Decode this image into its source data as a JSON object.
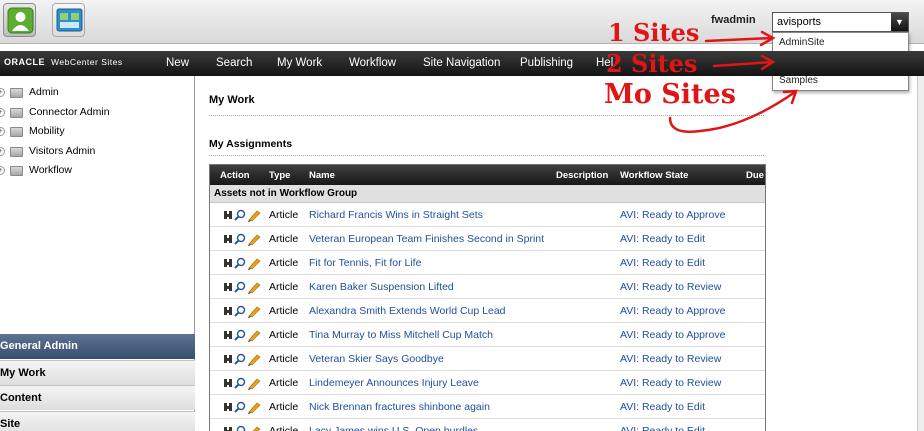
{
  "topbar": {
    "user": "fwadmin",
    "site_selected": "avisports",
    "site_options": [
      "AdminSite",
      "avisports",
      "Samples"
    ]
  },
  "navbar": {
    "logo": "ORACLE",
    "logo_sub": "WebCenter Sites",
    "items": [
      "New",
      "Search",
      "My Work",
      "Workflow",
      "Site Navigation",
      "Publishing",
      "Hel"
    ]
  },
  "sidebar": {
    "tree": [
      "Admin",
      "Connector Admin",
      "Mobility",
      "Visitors Admin",
      "Workflow"
    ],
    "accordion": [
      "General Admin",
      "My Work",
      "Content",
      "Site"
    ]
  },
  "main": {
    "title": "My Work",
    "section": "My Assignments",
    "columns": {
      "action": "Action",
      "type": "Type",
      "name": "Name",
      "description": "Description",
      "workflow_state": "Workflow State",
      "due": "Due"
    },
    "group": "Assets not in Workflow Group",
    "rows": [
      {
        "type": "Article",
        "name": "Richard Francis Wins in Straight Sets",
        "state": "AVI: Ready to Approve"
      },
      {
        "type": "Article",
        "name": "Veteran European Team Finishes Second in Sprint",
        "state": "AVI: Ready to Edit"
      },
      {
        "type": "Article",
        "name": "Fit for Tennis, Fit for Life",
        "state": "AVI: Ready to Edit"
      },
      {
        "type": "Article",
        "name": "Karen Baker Suspension Lifted",
        "state": "AVI: Ready to Review"
      },
      {
        "type": "Article",
        "name": "Alexandra Smith Extends World Cup Lead",
        "state": "AVI: Ready to Approve"
      },
      {
        "type": "Article",
        "name": "Tina Murray to Miss Mitchell Cup Match",
        "state": "AVI: Ready to Approve"
      },
      {
        "type": "Article",
        "name": "Veteran Skier Says Goodbye",
        "state": "AVI: Ready to Review"
      },
      {
        "type": "Article",
        "name": "Lindemeyer Announces Injury Leave",
        "state": "AVI: Ready to Review"
      },
      {
        "type": "Article",
        "name": "Nick Brennan fractures shinbone again",
        "state": "AVI: Ready to Edit"
      },
      {
        "type": "Article",
        "name": "Lacy James wins U.S. Open hurdles",
        "state": "AVI: Ready to Edit"
      }
    ]
  },
  "annotations": [
    "1 Sites",
    "2 Sites",
    "Mo Sites"
  ],
  "colors": {
    "accent_link": "#1f4f9a",
    "annotation": "#e01515",
    "nav_bg": "#1e1e1e",
    "accordion_active": "#4a5f80"
  }
}
